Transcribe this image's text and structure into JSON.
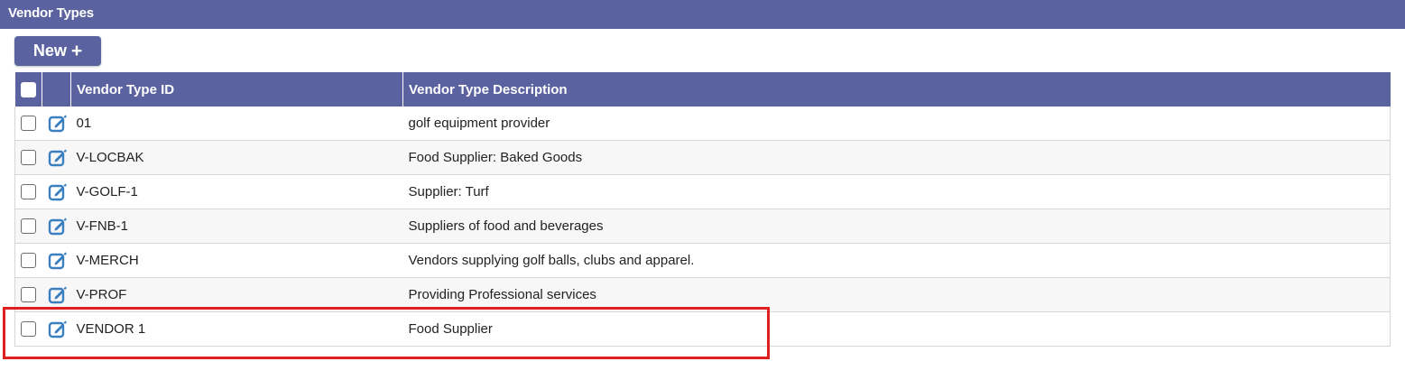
{
  "page": {
    "title": "Vendor Types"
  },
  "toolbar": {
    "new_label": "New",
    "new_icon": "plus-icon"
  },
  "table": {
    "columns": [
      "Vendor Type ID",
      "Vendor Type Description"
    ],
    "rows": [
      {
        "id": "01",
        "description": "golf equipment provider"
      },
      {
        "id": "V-LOCBAK",
        "description": "Food Supplier: Baked Goods"
      },
      {
        "id": "V-GOLF-1",
        "description": "Supplier: Turf"
      },
      {
        "id": "V-FNB-1",
        "description": "Suppliers of food and beverages"
      },
      {
        "id": "V-MERCH",
        "description": "Vendors supplying golf balls, clubs and apparel."
      },
      {
        "id": "V-PROF",
        "description": "Providing Professional services"
      },
      {
        "id": "VENDOR 1",
        "description": "Food Supplier"
      }
    ]
  },
  "colors": {
    "header_bg": "#5a63a0",
    "edit_icon": "#3a7fc0",
    "highlight": "#e02020"
  }
}
